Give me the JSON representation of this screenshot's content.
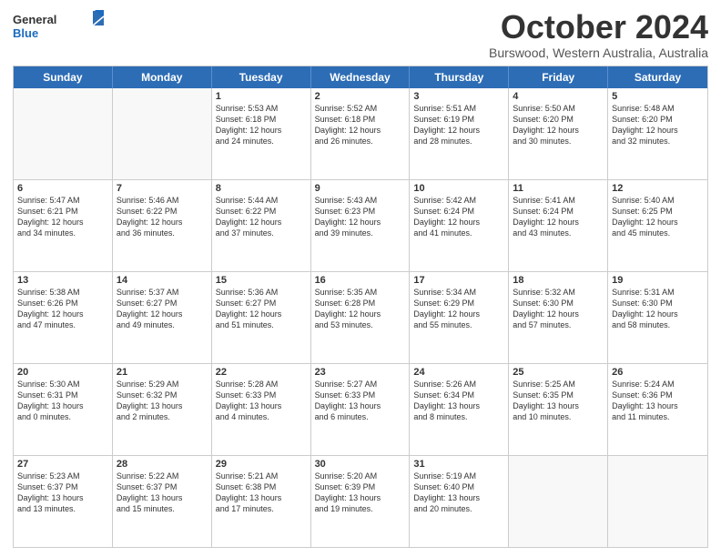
{
  "logo": {
    "general": "General",
    "blue": "Blue"
  },
  "header": {
    "title": "October 2024",
    "subtitle": "Burswood, Western Australia, Australia"
  },
  "weekdays": [
    "Sunday",
    "Monday",
    "Tuesday",
    "Wednesday",
    "Thursday",
    "Friday",
    "Saturday"
  ],
  "weeks": [
    [
      {
        "day": "",
        "info": ""
      },
      {
        "day": "",
        "info": ""
      },
      {
        "day": "1",
        "info": "Sunrise: 5:53 AM\nSunset: 6:18 PM\nDaylight: 12 hours\nand 24 minutes."
      },
      {
        "day": "2",
        "info": "Sunrise: 5:52 AM\nSunset: 6:18 PM\nDaylight: 12 hours\nand 26 minutes."
      },
      {
        "day": "3",
        "info": "Sunrise: 5:51 AM\nSunset: 6:19 PM\nDaylight: 12 hours\nand 28 minutes."
      },
      {
        "day": "4",
        "info": "Sunrise: 5:50 AM\nSunset: 6:20 PM\nDaylight: 12 hours\nand 30 minutes."
      },
      {
        "day": "5",
        "info": "Sunrise: 5:48 AM\nSunset: 6:20 PM\nDaylight: 12 hours\nand 32 minutes."
      }
    ],
    [
      {
        "day": "6",
        "info": "Sunrise: 5:47 AM\nSunset: 6:21 PM\nDaylight: 12 hours\nand 34 minutes."
      },
      {
        "day": "7",
        "info": "Sunrise: 5:46 AM\nSunset: 6:22 PM\nDaylight: 12 hours\nand 36 minutes."
      },
      {
        "day": "8",
        "info": "Sunrise: 5:44 AM\nSunset: 6:22 PM\nDaylight: 12 hours\nand 37 minutes."
      },
      {
        "day": "9",
        "info": "Sunrise: 5:43 AM\nSunset: 6:23 PM\nDaylight: 12 hours\nand 39 minutes."
      },
      {
        "day": "10",
        "info": "Sunrise: 5:42 AM\nSunset: 6:24 PM\nDaylight: 12 hours\nand 41 minutes."
      },
      {
        "day": "11",
        "info": "Sunrise: 5:41 AM\nSunset: 6:24 PM\nDaylight: 12 hours\nand 43 minutes."
      },
      {
        "day": "12",
        "info": "Sunrise: 5:40 AM\nSunset: 6:25 PM\nDaylight: 12 hours\nand 45 minutes."
      }
    ],
    [
      {
        "day": "13",
        "info": "Sunrise: 5:38 AM\nSunset: 6:26 PM\nDaylight: 12 hours\nand 47 minutes."
      },
      {
        "day": "14",
        "info": "Sunrise: 5:37 AM\nSunset: 6:27 PM\nDaylight: 12 hours\nand 49 minutes."
      },
      {
        "day": "15",
        "info": "Sunrise: 5:36 AM\nSunset: 6:27 PM\nDaylight: 12 hours\nand 51 minutes."
      },
      {
        "day": "16",
        "info": "Sunrise: 5:35 AM\nSunset: 6:28 PM\nDaylight: 12 hours\nand 53 minutes."
      },
      {
        "day": "17",
        "info": "Sunrise: 5:34 AM\nSunset: 6:29 PM\nDaylight: 12 hours\nand 55 minutes."
      },
      {
        "day": "18",
        "info": "Sunrise: 5:32 AM\nSunset: 6:30 PM\nDaylight: 12 hours\nand 57 minutes."
      },
      {
        "day": "19",
        "info": "Sunrise: 5:31 AM\nSunset: 6:30 PM\nDaylight: 12 hours\nand 58 minutes."
      }
    ],
    [
      {
        "day": "20",
        "info": "Sunrise: 5:30 AM\nSunset: 6:31 PM\nDaylight: 13 hours\nand 0 minutes."
      },
      {
        "day": "21",
        "info": "Sunrise: 5:29 AM\nSunset: 6:32 PM\nDaylight: 13 hours\nand 2 minutes."
      },
      {
        "day": "22",
        "info": "Sunrise: 5:28 AM\nSunset: 6:33 PM\nDaylight: 13 hours\nand 4 minutes."
      },
      {
        "day": "23",
        "info": "Sunrise: 5:27 AM\nSunset: 6:33 PM\nDaylight: 13 hours\nand 6 minutes."
      },
      {
        "day": "24",
        "info": "Sunrise: 5:26 AM\nSunset: 6:34 PM\nDaylight: 13 hours\nand 8 minutes."
      },
      {
        "day": "25",
        "info": "Sunrise: 5:25 AM\nSunset: 6:35 PM\nDaylight: 13 hours\nand 10 minutes."
      },
      {
        "day": "26",
        "info": "Sunrise: 5:24 AM\nSunset: 6:36 PM\nDaylight: 13 hours\nand 11 minutes."
      }
    ],
    [
      {
        "day": "27",
        "info": "Sunrise: 5:23 AM\nSunset: 6:37 PM\nDaylight: 13 hours\nand 13 minutes."
      },
      {
        "day": "28",
        "info": "Sunrise: 5:22 AM\nSunset: 6:37 PM\nDaylight: 13 hours\nand 15 minutes."
      },
      {
        "day": "29",
        "info": "Sunrise: 5:21 AM\nSunset: 6:38 PM\nDaylight: 13 hours\nand 17 minutes."
      },
      {
        "day": "30",
        "info": "Sunrise: 5:20 AM\nSunset: 6:39 PM\nDaylight: 13 hours\nand 19 minutes."
      },
      {
        "day": "31",
        "info": "Sunrise: 5:19 AM\nSunset: 6:40 PM\nDaylight: 13 hours\nand 20 minutes."
      },
      {
        "day": "",
        "info": ""
      },
      {
        "day": "",
        "info": ""
      }
    ]
  ]
}
